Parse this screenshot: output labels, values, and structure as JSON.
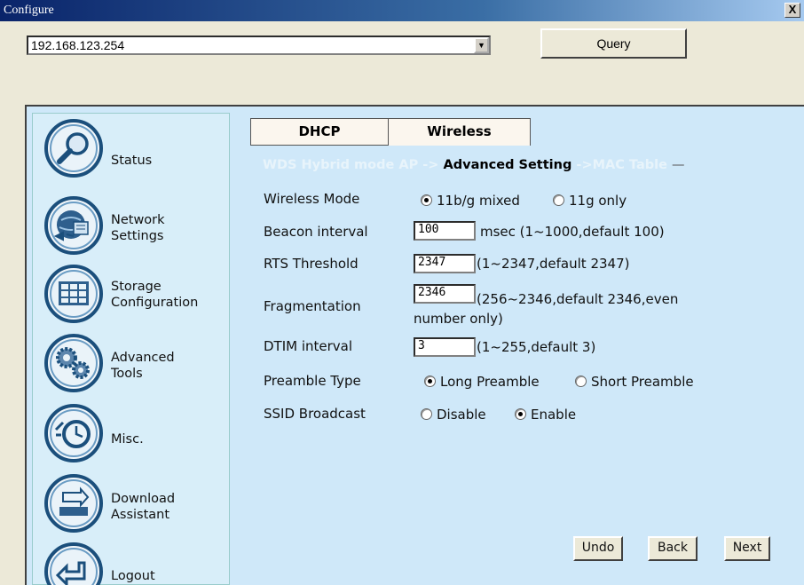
{
  "window": {
    "title": "Configure",
    "close_label": "X"
  },
  "toolbar": {
    "ip_value": "192.168.123.254",
    "dropdown_arrow": "▼",
    "query_label": "Query"
  },
  "sidebar": {
    "items": [
      {
        "label": "Status",
        "icon": "magnifier-icon"
      },
      {
        "label": "Network\nSettings",
        "icon": "network-icon"
      },
      {
        "label": "Storage\nConfiguration",
        "icon": "storage-grid-icon"
      },
      {
        "label": "Advanced\nTools",
        "icon": "gears-icon"
      },
      {
        "label": "Misc.",
        "icon": "clock-icon"
      },
      {
        "label": "Download\nAssistant",
        "icon": "download-tray-icon"
      },
      {
        "label": "Logout",
        "icon": "logout-arrow-icon"
      }
    ]
  },
  "tabs": [
    {
      "label": "DHCP"
    },
    {
      "label": "Wireless"
    }
  ],
  "breadcrumb": {
    "items": [
      {
        "label": "WDS Hybrid mode AP"
      },
      {
        "label": "->"
      },
      {
        "label": "Advanced Setting"
      },
      {
        "label": "->MAC Table"
      },
      {
        "label": "—"
      }
    ]
  },
  "form": {
    "wireless_mode": {
      "label": "Wireless Mode",
      "option1": "11b/g mixed",
      "option2": "11g only",
      "selected": "11b/g mixed"
    },
    "beacon_interval": {
      "label": "Beacon interval",
      "value": "100",
      "hint": "msec (1~1000,default 100)"
    },
    "rts_threshold": {
      "label": "RTS Threshold",
      "value": "2347",
      "hint": "(1~2347,default 2347)"
    },
    "fragmentation": {
      "label": "Fragmentation",
      "value": "2346",
      "hint1": "(256~2346,default 2346,even",
      "hint2": "number only)"
    },
    "dtim_interval": {
      "label": "DTIM interval",
      "value": "3",
      "hint": "(1~255,default 3)"
    },
    "preamble_type": {
      "label": "Preamble Type",
      "option1": "Long Preamble",
      "option2": "Short Preamble",
      "selected": "Long Preamble"
    },
    "ssid_broadcast": {
      "label": "SSID Broadcast",
      "option1": "Disable",
      "option2": "Enable",
      "selected": "Enable"
    }
  },
  "buttons": {
    "undo": "Undo",
    "back": "Back",
    "next": "Next"
  },
  "colors": {
    "title_bar": "#0a246a",
    "panel_bg": "#cfe8f9",
    "sidebar_bg": "#d8eef9",
    "tab_bg": "#fbf6ee"
  }
}
